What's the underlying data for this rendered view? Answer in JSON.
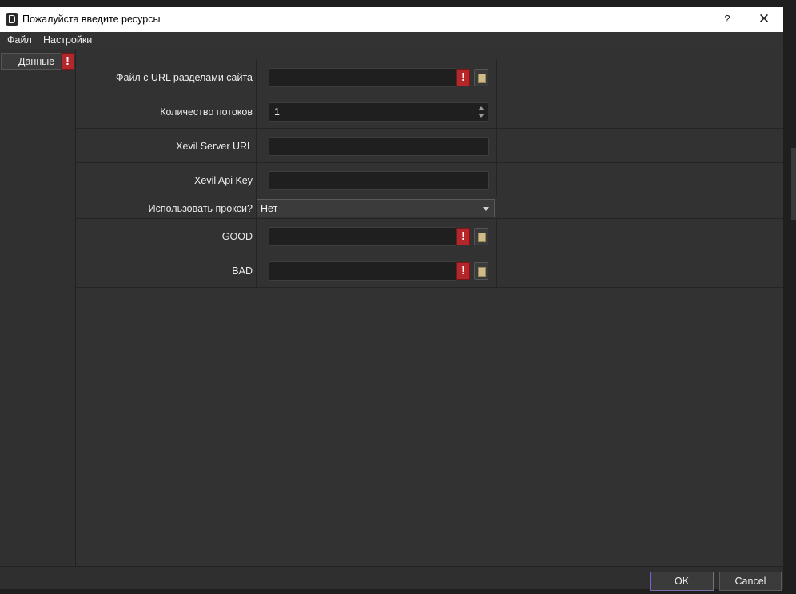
{
  "window": {
    "title": "Пожалуйста введите ресурсы",
    "help_label": "?",
    "close_label": "✕"
  },
  "menu": {
    "file": "Файл",
    "settings": "Настройки"
  },
  "sidebar": {
    "tabs": [
      {
        "label": "Данные",
        "warning": "!"
      }
    ]
  },
  "form": {
    "fields": [
      {
        "label": "Файл с URL разделами сайта",
        "value": "",
        "warning": "!"
      },
      {
        "label": "Количество потоков",
        "value": "1"
      },
      {
        "label": "Xevil Server URL",
        "value": ""
      },
      {
        "label": "Xevil Api Key",
        "value": ""
      },
      {
        "label": "Использовать прокси?",
        "value": "Нет"
      },
      {
        "label": "GOOD",
        "value": "",
        "warning": "!"
      },
      {
        "label": "BAD",
        "value": "",
        "warning": "!"
      }
    ]
  },
  "footer": {
    "ok_label": "OK",
    "cancel_label": "Cancel"
  },
  "colors": {
    "warning": "#b3262a",
    "background": "#323232",
    "ok_border": "#7b6aa6"
  }
}
